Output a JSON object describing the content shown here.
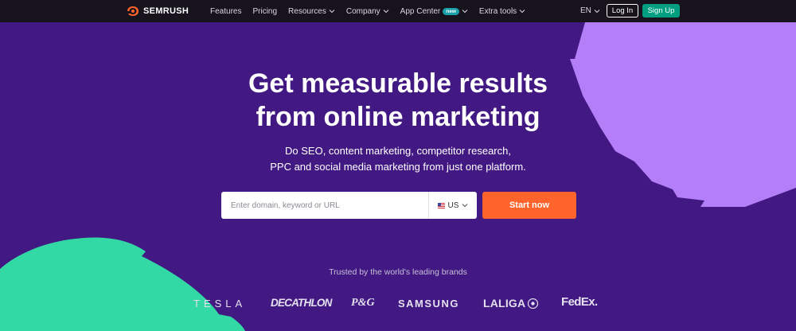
{
  "header": {
    "logo_text": "SEMRUSH",
    "nav": [
      {
        "label": "Features",
        "has_dropdown": false
      },
      {
        "label": "Pricing",
        "has_dropdown": false
      },
      {
        "label": "Resources",
        "has_dropdown": true
      },
      {
        "label": "Company",
        "has_dropdown": true
      },
      {
        "label": "App Center",
        "has_dropdown": true,
        "badge": "new"
      },
      {
        "label": "Extra tools",
        "has_dropdown": true
      }
    ],
    "language": "EN",
    "login_label": "Log In",
    "signup_label": "Sign Up"
  },
  "hero": {
    "title_line1": "Get measurable results",
    "title_line2": "from online marketing",
    "subtitle_line1": "Do SEO, content marketing, competitor research,",
    "subtitle_line2": "PPC and social media marketing from just one platform."
  },
  "search": {
    "placeholder": "Enter domain, keyword or URL",
    "country": "US",
    "submit_label": "Start now"
  },
  "brands": {
    "heading": "Trusted by the world's leading brands",
    "logos": [
      {
        "name": "TESLA",
        "text": "TESLA"
      },
      {
        "name": "DECATHLON",
        "text": "DECATHLON"
      },
      {
        "name": "P&G",
        "text": "P&G"
      },
      {
        "name": "SAMSUNG",
        "text": "SAMSUNG"
      },
      {
        "name": "LALIGA",
        "text": "LALIGA"
      },
      {
        "name": "FedEx",
        "text": "FedEx."
      }
    ]
  },
  "colors": {
    "background": "#421983",
    "topbar": "#16131c",
    "accent_orange": "#ff642d",
    "signup_green": "#009f81",
    "badge_teal": "#19a0a8",
    "shape_lavender": "#b47ef8",
    "shape_teal": "#33d9a4"
  },
  "icons": {
    "logo": "semrush-flame-icon",
    "chevron": "chevron-down-icon",
    "flag": "us-flag-icon"
  }
}
